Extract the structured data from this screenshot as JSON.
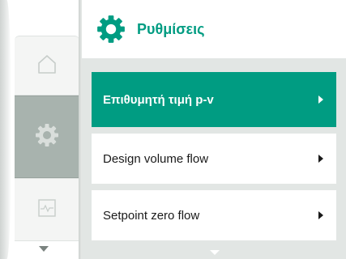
{
  "header": {
    "title": "Ρυθμίσεις",
    "icon": "gear-icon",
    "accent_color": "#009c82"
  },
  "sidebar": {
    "items": [
      {
        "icon": "home-icon",
        "selected": false
      },
      {
        "icon": "gear-icon",
        "selected": true
      },
      {
        "icon": "trend-icon",
        "selected": false
      }
    ],
    "scroll_icon": "chevron-down-icon"
  },
  "menu": {
    "items": [
      {
        "label": "Επιθυμητή τιμή p-v",
        "selected": true,
        "icon": "chevron-right-icon"
      },
      {
        "label": "Design volume flow",
        "selected": false,
        "icon": "chevron-right-icon"
      },
      {
        "label": "Setpoint zero flow",
        "selected": false,
        "icon": "chevron-right-icon"
      }
    ],
    "scroll_icon": "chevron-down-icon"
  }
}
